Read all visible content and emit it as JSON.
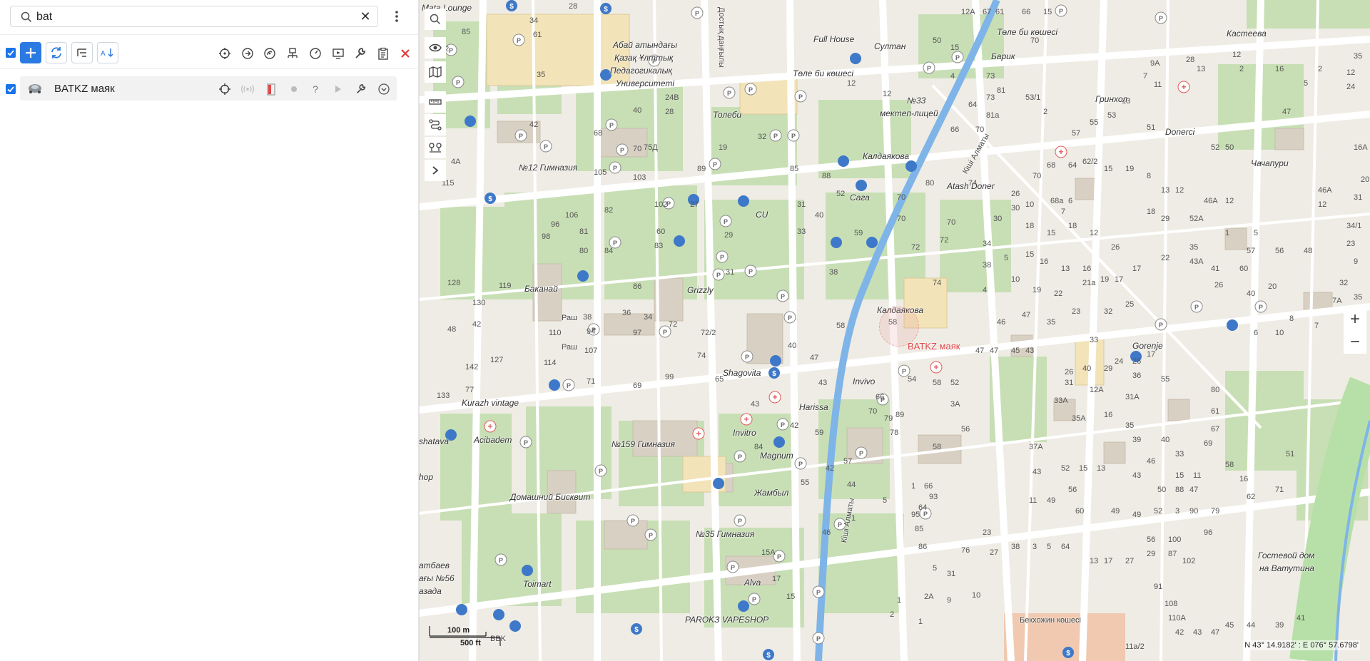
{
  "search": {
    "value": "bat"
  },
  "layer": {
    "name": "BATKZ маяк"
  },
  "map": {
    "beacon_label": "BATKZ маяк",
    "scale": {
      "metric": "100 m",
      "imperial": "500 ft"
    },
    "coords": "N 43° 14.9182' : E 076° 57.6798'",
    "zoom_in": "+",
    "zoom_out": "−",
    "labels": {
      "abai_univ_1": "Абай атындағы",
      "abai_univ_2": "Қазақ Ұлттық",
      "abai_univ_3": "Педагогикалық",
      "abai_univ_4": "Университеті",
      "tole_bi_1": "Төле би көшесі",
      "tole_bi_2": "Төле би көшесі",
      "tole_bi_short": "Толеби",
      "full_house": "Full House",
      "sultan": "Султан",
      "barik": "Барик",
      "kasteeva": "Кастеева",
      "grinhol": "Гринхол",
      "donerci": "Donerci",
      "chachapuri": "Чачапури",
      "school33_1": "№33",
      "school33_2": "мектеп-лицей",
      "kaldayakova_1": "Калдаякова",
      "kaldayakova_2": "Калдаякова",
      "atash": "Atash Doner",
      "gymn12": "№12 Гимназия",
      "cu": "CU",
      "saga": "Сага",
      "bakanai": "Баканай",
      "grizzly": "Grizzly",
      "shagovita": "Shagovita",
      "invivo": "Invivo",
      "harissa": "Harissa",
      "kurazh": "Kurazh vintage",
      "acibadem": "Acibadem",
      "gymn159": "№159 Гимназия",
      "invitro": "Invitro",
      "magnum": "Magnum",
      "domashny": "Домашний Бисквит",
      "zhambyl": "Жамбыл",
      "gymn35": "№35 Гимназия",
      "toimart": "Toimart",
      "alva": "Alva",
      "parokz": "PAROKЗ VAPESHOP",
      "mata": "Mata Lounge",
      "gorenje": "Gorenje",
      "guest_1": "Гостевой дом",
      "guest_2": "на Ватутина",
      "kashi_1": "Кіші Алматы",
      "kashi_2": "Кіші Алматы",
      "dostyk": "Достық даңғылы",
      "raw": "Раш",
      "shatava": "shatava",
      "hop": "hop",
      "ataev": "атбаев",
      "agy56": "ағы №56",
      "aza": "азада",
      "bbk": "BBK",
      "bekh": "Бекхожин көшесі"
    }
  }
}
